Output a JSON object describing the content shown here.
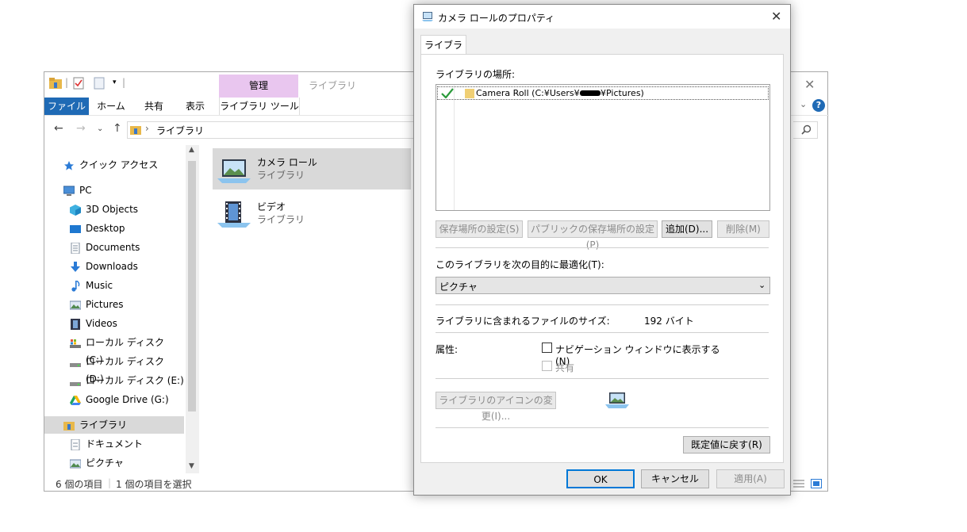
{
  "explorer": {
    "quick_access_caption": "|",
    "tabs": {
      "file": "ファイル",
      "home": "ホーム",
      "share": "共有",
      "view": "表示"
    },
    "context_tab_header": "管理",
    "context_tab": "ライブラリ ツール",
    "window_title": "ライブラリ",
    "address": {
      "crumb_sep": "›",
      "path": "ライブラリ"
    },
    "nav": {
      "quick_access": "クイック アクセス",
      "pc": "PC",
      "objects3d": "3D Objects",
      "desktop": "Desktop",
      "documents": "Documents",
      "downloads": "Downloads",
      "music": "Music",
      "pictures": "Pictures",
      "videos": "Videos",
      "disk_c": "ローカル ディスク (C:)",
      "disk_d": "ローカル ディスク (D:)",
      "disk_e": "ローカル ディスク (E:)",
      "google_drive": "Google Drive (G:)",
      "libraries": "ライブラリ",
      "lib_documents": "ドキュメント",
      "lib_pictures": "ピクチャ"
    },
    "items": [
      {
        "name": "カメラ ロール",
        "type": "ライブラリ"
      },
      {
        "name": "ビデオ",
        "type": "ライブラリ"
      }
    ],
    "status": {
      "count": "6 個の項目",
      "selected": "1 個の項目を選択"
    }
  },
  "dialog": {
    "title": "カメラ ロールのプロパティ",
    "tab": "ライブラリ",
    "locations_label": "ライブラリの場所:",
    "location_path": "Camera Roll (C:¥Users¥",
    "location_path_end": "¥Pictures)",
    "buttons": {
      "set_save": "保存場所の設定(S)",
      "set_public": "パブリックの保存場所の設定(P)",
      "add": "追加(D)...",
      "remove": "削除(M)",
      "change_icon": "ライブラリのアイコンの変更(I)...",
      "restore": "既定値に戻す(R)",
      "ok": "OK",
      "cancel": "キャンセル",
      "apply": "適用(A)"
    },
    "optimize_label": "このライブラリを次の目的に最適化(T):",
    "optimize_value": "ピクチャ",
    "size_label": "ライブラリに含まれるファイルのサイズ:",
    "size_value": "192 バイト",
    "attr_label": "属性:",
    "show_nav_label": "ナビゲーション ウィンドウに表示する(N)",
    "shared_label": "共有"
  },
  "colors": {
    "accent": "#1f6ab5",
    "manage_tab": "#e9c6ef",
    "selection": "#d9d9d9",
    "focus": "#0078d7"
  }
}
